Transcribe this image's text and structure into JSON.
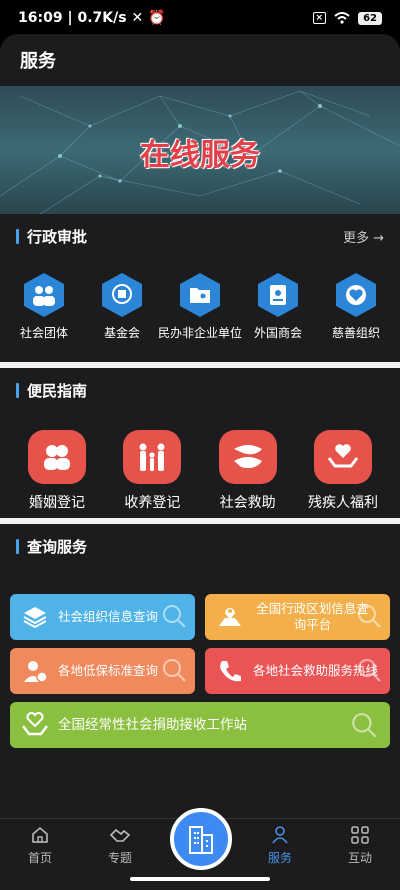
{
  "status": {
    "time": "16:09",
    "speed": "0.7K/s",
    "battery": "62"
  },
  "appbar": {
    "title": "服务"
  },
  "banner": {
    "title": "在线服务"
  },
  "admin": {
    "title": "行政审批",
    "more": "更多",
    "items": [
      {
        "label": "社会团体",
        "icon": "people-icon"
      },
      {
        "label": "基金会",
        "icon": "fund-icon"
      },
      {
        "label": "民办非企业单位",
        "icon": "folder-user-icon"
      },
      {
        "label": "外国商会",
        "icon": "passport-icon"
      },
      {
        "label": "慈善组织",
        "icon": "heart-icon"
      }
    ]
  },
  "guide": {
    "title": "便民指南",
    "items": [
      {
        "label": "婚姻登记",
        "icon": "couple-icon"
      },
      {
        "label": "收养登记",
        "icon": "family-icon"
      },
      {
        "label": "社会救助",
        "icon": "hands-icon"
      },
      {
        "label": "残疾人福利",
        "icon": "care-heart-icon"
      }
    ]
  },
  "query": {
    "title": "查询服务",
    "items": [
      {
        "label": "社会组织信息查询",
        "color": "#4fb3e8",
        "icon": "layers-icon"
      },
      {
        "label": "全国行政区划信息查询平台",
        "color": "#f3b04a",
        "icon": "map-pin-icon"
      },
      {
        "label": "各地低保标准查询",
        "color": "#f08a5d",
        "icon": "user-coin-icon"
      },
      {
        "label": "各地社会救助服务热线",
        "color": "#ea5455",
        "icon": "phone-icon"
      },
      {
        "label": "全国经常性社会捐助接收工作站",
        "color": "#8bbf3f",
        "icon": "heart-hand-icon"
      }
    ]
  },
  "tabs": [
    {
      "label": "首页",
      "icon": "home-icon"
    },
    {
      "label": "专题",
      "icon": "handshake-icon"
    },
    {
      "label": "服务",
      "icon": "person-icon"
    },
    {
      "label": "互动",
      "icon": "grid-icon"
    }
  ],
  "colors": {
    "accent": "#4a90e2",
    "hex_blue": "#2c86d8",
    "card_red": "#e5534b"
  }
}
